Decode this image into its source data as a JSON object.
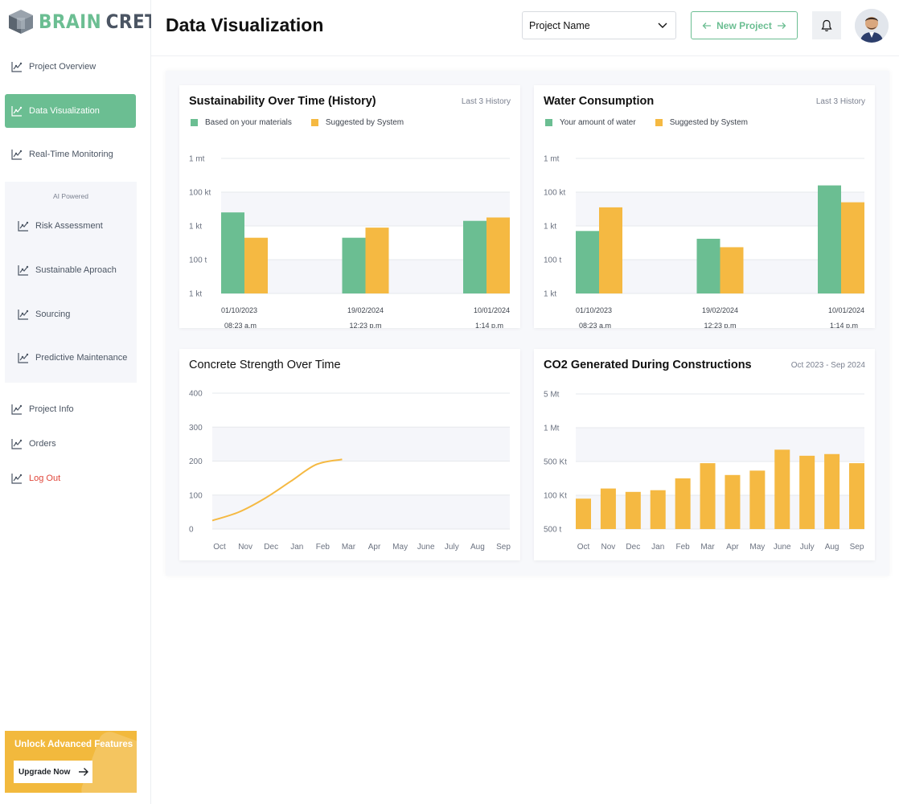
{
  "brand": {
    "part1": "BRAIN",
    "part2": "CRETE"
  },
  "sidebar": {
    "items": [
      {
        "label": "Project Overview"
      },
      {
        "label": "Data Visualization"
      },
      {
        "label": "Real-Time Monitoring"
      }
    ],
    "ai_section": {
      "label": "AI Powered",
      "items": [
        {
          "label": "Risk Assessment"
        },
        {
          "label": "Sustainable Aproach"
        },
        {
          "label": "Sourcing"
        },
        {
          "label": "Predictive Maintenance"
        }
      ]
    },
    "bottom_items": [
      {
        "label": "Project Info"
      },
      {
        "label": "Orders"
      },
      {
        "label": "Log Out"
      }
    ],
    "upgrade": {
      "title": "Unlock Advanced Features",
      "button": "Upgrade Now"
    }
  },
  "header": {
    "title": "Data Visualization",
    "project_select": "Project Name",
    "new_project": "New Project"
  },
  "colors": {
    "green": "#6bbe92",
    "yellow": "#f5b942",
    "logout": "#e0463a"
  },
  "cards": {
    "sustainability": {
      "title": "Sustainability Over Time (History)",
      "meta": "Last 3 History",
      "legend": [
        "Based on your materials",
        "Suggested by System"
      ]
    },
    "water": {
      "title": "Water Consumption",
      "meta": "Last 3 History",
      "legend": [
        "Your amount of water",
        "Suggested by System"
      ]
    },
    "concrete": {
      "title": "Concrete Strength Over Time"
    },
    "co2": {
      "title": "CO2 Generated During Constructions",
      "meta": "Oct 2023 - Sep 2024"
    }
  },
  "chart_data": [
    {
      "id": "sustainability",
      "type": "bar",
      "title": "Sustainability Over Time (History)",
      "y_ticks": [
        "1 mt",
        "100 kt",
        "1 kt",
        "100 t",
        "1 kt"
      ],
      "ylim": [
        0,
        4
      ],
      "categories": [
        "01/10/2023",
        "19/02/2024",
        "10/01/2024"
      ],
      "times": [
        "08:23 a.m",
        "12:23 p.m",
        "1:14 p.m"
      ],
      "series": [
        {
          "name": "Based on your materials",
          "color": "#6bbe92",
          "values": [
            2.4,
            1.65,
            2.15
          ]
        },
        {
          "name": "Suggested by System",
          "color": "#f5b942",
          "values": [
            1.65,
            1.95,
            2.25
          ]
        }
      ]
    },
    {
      "id": "water",
      "type": "bar",
      "title": "Water Consumption",
      "y_ticks": [
        "1 mt",
        "100 kt",
        "1 kt",
        "100 t",
        "1 kt"
      ],
      "ylim": [
        0,
        4
      ],
      "categories": [
        "01/10/2023",
        "19/02/2024",
        "10/01/2024"
      ],
      "times": [
        "08:23 a.m",
        "12:23 p.m",
        "1:14 p.m"
      ],
      "series": [
        {
          "name": "Your amount of water",
          "color": "#6bbe92",
          "values": [
            1.85,
            1.62,
            3.2
          ]
        },
        {
          "name": "Suggested by System",
          "color": "#f5b942",
          "values": [
            2.55,
            1.37,
            2.7
          ]
        }
      ]
    },
    {
      "id": "concrete",
      "type": "line",
      "title": "Concrete Strength Over Time",
      "y_ticks": [
        "400",
        "300",
        "200",
        "100",
        "0"
      ],
      "ylim": [
        0,
        400
      ],
      "categories": [
        "Oct",
        "Nov",
        "Dec",
        "Jan",
        "Feb",
        "Mar",
        "Apr",
        "May",
        "June",
        "July",
        "Aug",
        "Sep"
      ],
      "series": [
        {
          "name": "Strength",
          "color": "#f5b942",
          "values": [
            25,
            50,
            90,
            140,
            190,
            205
          ]
        }
      ]
    },
    {
      "id": "co2",
      "type": "bar",
      "title": "CO2 Generated During Constructions",
      "y_ticks": [
        "5 Mt",
        "1 Mt",
        "500 Kt",
        "100 Kt",
        "500 t"
      ],
      "ylim": [
        0,
        4
      ],
      "categories": [
        "Oct",
        "Nov",
        "Dec",
        "Jan",
        "Feb",
        "Mar",
        "Apr",
        "May",
        "June",
        "July",
        "Aug",
        "Sep"
      ],
      "series": [
        {
          "name": "CO2",
          "color": "#f5b942",
          "values": [
            0.9,
            1.2,
            1.1,
            1.15,
            1.5,
            1.95,
            1.6,
            1.73,
            2.35,
            2.17,
            2.22,
            1.95
          ]
        }
      ]
    }
  ]
}
